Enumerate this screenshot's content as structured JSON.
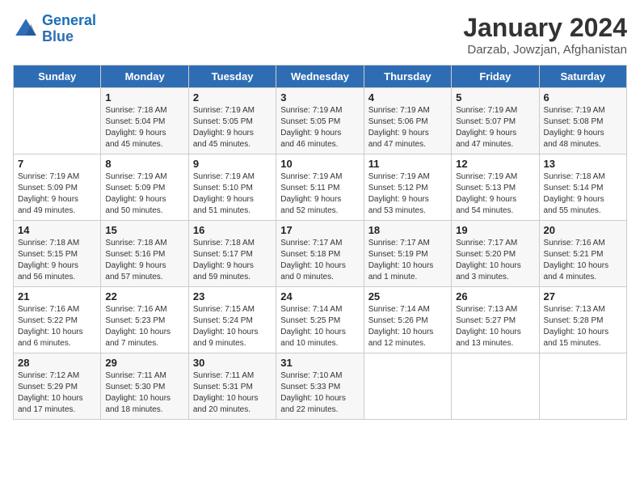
{
  "logo": {
    "line1": "General",
    "line2": "Blue"
  },
  "title": "January 2024",
  "subtitle": "Darzab, Jowzjan, Afghanistan",
  "days_header": [
    "Sunday",
    "Monday",
    "Tuesday",
    "Wednesday",
    "Thursday",
    "Friday",
    "Saturday"
  ],
  "weeks": [
    [
      {
        "num": "",
        "detail": ""
      },
      {
        "num": "1",
        "detail": "Sunrise: 7:18 AM\nSunset: 5:04 PM\nDaylight: 9 hours\nand 45 minutes."
      },
      {
        "num": "2",
        "detail": "Sunrise: 7:19 AM\nSunset: 5:05 PM\nDaylight: 9 hours\nand 45 minutes."
      },
      {
        "num": "3",
        "detail": "Sunrise: 7:19 AM\nSunset: 5:05 PM\nDaylight: 9 hours\nand 46 minutes."
      },
      {
        "num": "4",
        "detail": "Sunrise: 7:19 AM\nSunset: 5:06 PM\nDaylight: 9 hours\nand 47 minutes."
      },
      {
        "num": "5",
        "detail": "Sunrise: 7:19 AM\nSunset: 5:07 PM\nDaylight: 9 hours\nand 47 minutes."
      },
      {
        "num": "6",
        "detail": "Sunrise: 7:19 AM\nSunset: 5:08 PM\nDaylight: 9 hours\nand 48 minutes."
      }
    ],
    [
      {
        "num": "7",
        "detail": "Sunrise: 7:19 AM\nSunset: 5:09 PM\nDaylight: 9 hours\nand 49 minutes."
      },
      {
        "num": "8",
        "detail": "Sunrise: 7:19 AM\nSunset: 5:09 PM\nDaylight: 9 hours\nand 50 minutes."
      },
      {
        "num": "9",
        "detail": "Sunrise: 7:19 AM\nSunset: 5:10 PM\nDaylight: 9 hours\nand 51 minutes."
      },
      {
        "num": "10",
        "detail": "Sunrise: 7:19 AM\nSunset: 5:11 PM\nDaylight: 9 hours\nand 52 minutes."
      },
      {
        "num": "11",
        "detail": "Sunrise: 7:19 AM\nSunset: 5:12 PM\nDaylight: 9 hours\nand 53 minutes."
      },
      {
        "num": "12",
        "detail": "Sunrise: 7:19 AM\nSunset: 5:13 PM\nDaylight: 9 hours\nand 54 minutes."
      },
      {
        "num": "13",
        "detail": "Sunrise: 7:18 AM\nSunset: 5:14 PM\nDaylight: 9 hours\nand 55 minutes."
      }
    ],
    [
      {
        "num": "14",
        "detail": "Sunrise: 7:18 AM\nSunset: 5:15 PM\nDaylight: 9 hours\nand 56 minutes."
      },
      {
        "num": "15",
        "detail": "Sunrise: 7:18 AM\nSunset: 5:16 PM\nDaylight: 9 hours\nand 57 minutes."
      },
      {
        "num": "16",
        "detail": "Sunrise: 7:18 AM\nSunset: 5:17 PM\nDaylight: 9 hours\nand 59 minutes."
      },
      {
        "num": "17",
        "detail": "Sunrise: 7:17 AM\nSunset: 5:18 PM\nDaylight: 10 hours\nand 0 minutes."
      },
      {
        "num": "18",
        "detail": "Sunrise: 7:17 AM\nSunset: 5:19 PM\nDaylight: 10 hours\nand 1 minute."
      },
      {
        "num": "19",
        "detail": "Sunrise: 7:17 AM\nSunset: 5:20 PM\nDaylight: 10 hours\nand 3 minutes."
      },
      {
        "num": "20",
        "detail": "Sunrise: 7:16 AM\nSunset: 5:21 PM\nDaylight: 10 hours\nand 4 minutes."
      }
    ],
    [
      {
        "num": "21",
        "detail": "Sunrise: 7:16 AM\nSunset: 5:22 PM\nDaylight: 10 hours\nand 6 minutes."
      },
      {
        "num": "22",
        "detail": "Sunrise: 7:16 AM\nSunset: 5:23 PM\nDaylight: 10 hours\nand 7 minutes."
      },
      {
        "num": "23",
        "detail": "Sunrise: 7:15 AM\nSunset: 5:24 PM\nDaylight: 10 hours\nand 9 minutes."
      },
      {
        "num": "24",
        "detail": "Sunrise: 7:14 AM\nSunset: 5:25 PM\nDaylight: 10 hours\nand 10 minutes."
      },
      {
        "num": "25",
        "detail": "Sunrise: 7:14 AM\nSunset: 5:26 PM\nDaylight: 10 hours\nand 12 minutes."
      },
      {
        "num": "26",
        "detail": "Sunrise: 7:13 AM\nSunset: 5:27 PM\nDaylight: 10 hours\nand 13 minutes."
      },
      {
        "num": "27",
        "detail": "Sunrise: 7:13 AM\nSunset: 5:28 PM\nDaylight: 10 hours\nand 15 minutes."
      }
    ],
    [
      {
        "num": "28",
        "detail": "Sunrise: 7:12 AM\nSunset: 5:29 PM\nDaylight: 10 hours\nand 17 minutes."
      },
      {
        "num": "29",
        "detail": "Sunrise: 7:11 AM\nSunset: 5:30 PM\nDaylight: 10 hours\nand 18 minutes."
      },
      {
        "num": "30",
        "detail": "Sunrise: 7:11 AM\nSunset: 5:31 PM\nDaylight: 10 hours\nand 20 minutes."
      },
      {
        "num": "31",
        "detail": "Sunrise: 7:10 AM\nSunset: 5:33 PM\nDaylight: 10 hours\nand 22 minutes."
      },
      {
        "num": "",
        "detail": ""
      },
      {
        "num": "",
        "detail": ""
      },
      {
        "num": "",
        "detail": ""
      }
    ]
  ]
}
